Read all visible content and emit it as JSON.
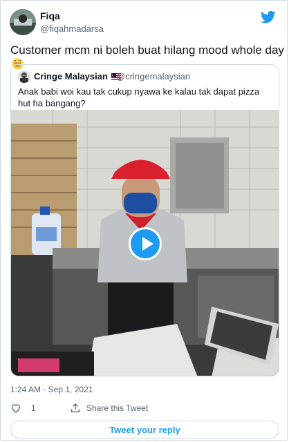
{
  "tweet": {
    "author_name": "Fiqa",
    "author_handle": "@fiqahmadarsa",
    "text": "Customer mcm ni boleh buat hilang mood whole day",
    "emoji_icon": "sad-relieved-face-emoji",
    "timestamp": "1:24 AM · Sep 1, 2021",
    "like_count": "1",
    "share_label": "Share this Tweet",
    "reply_button_label": "Tweet your reply",
    "accent_color": "#1d9bf0"
  },
  "quoted_tweet": {
    "author_name": "Cringe Malaysian",
    "author_handle": "@cringemalaysian",
    "text": "Anak babi woi kau tak cukup nyawa ke kalau tak dapat pizza hut ha bangang?",
    "flag_icon": "malaysia-flag-icon",
    "media": {
      "type": "video",
      "play_icon": "play-icon"
    }
  }
}
